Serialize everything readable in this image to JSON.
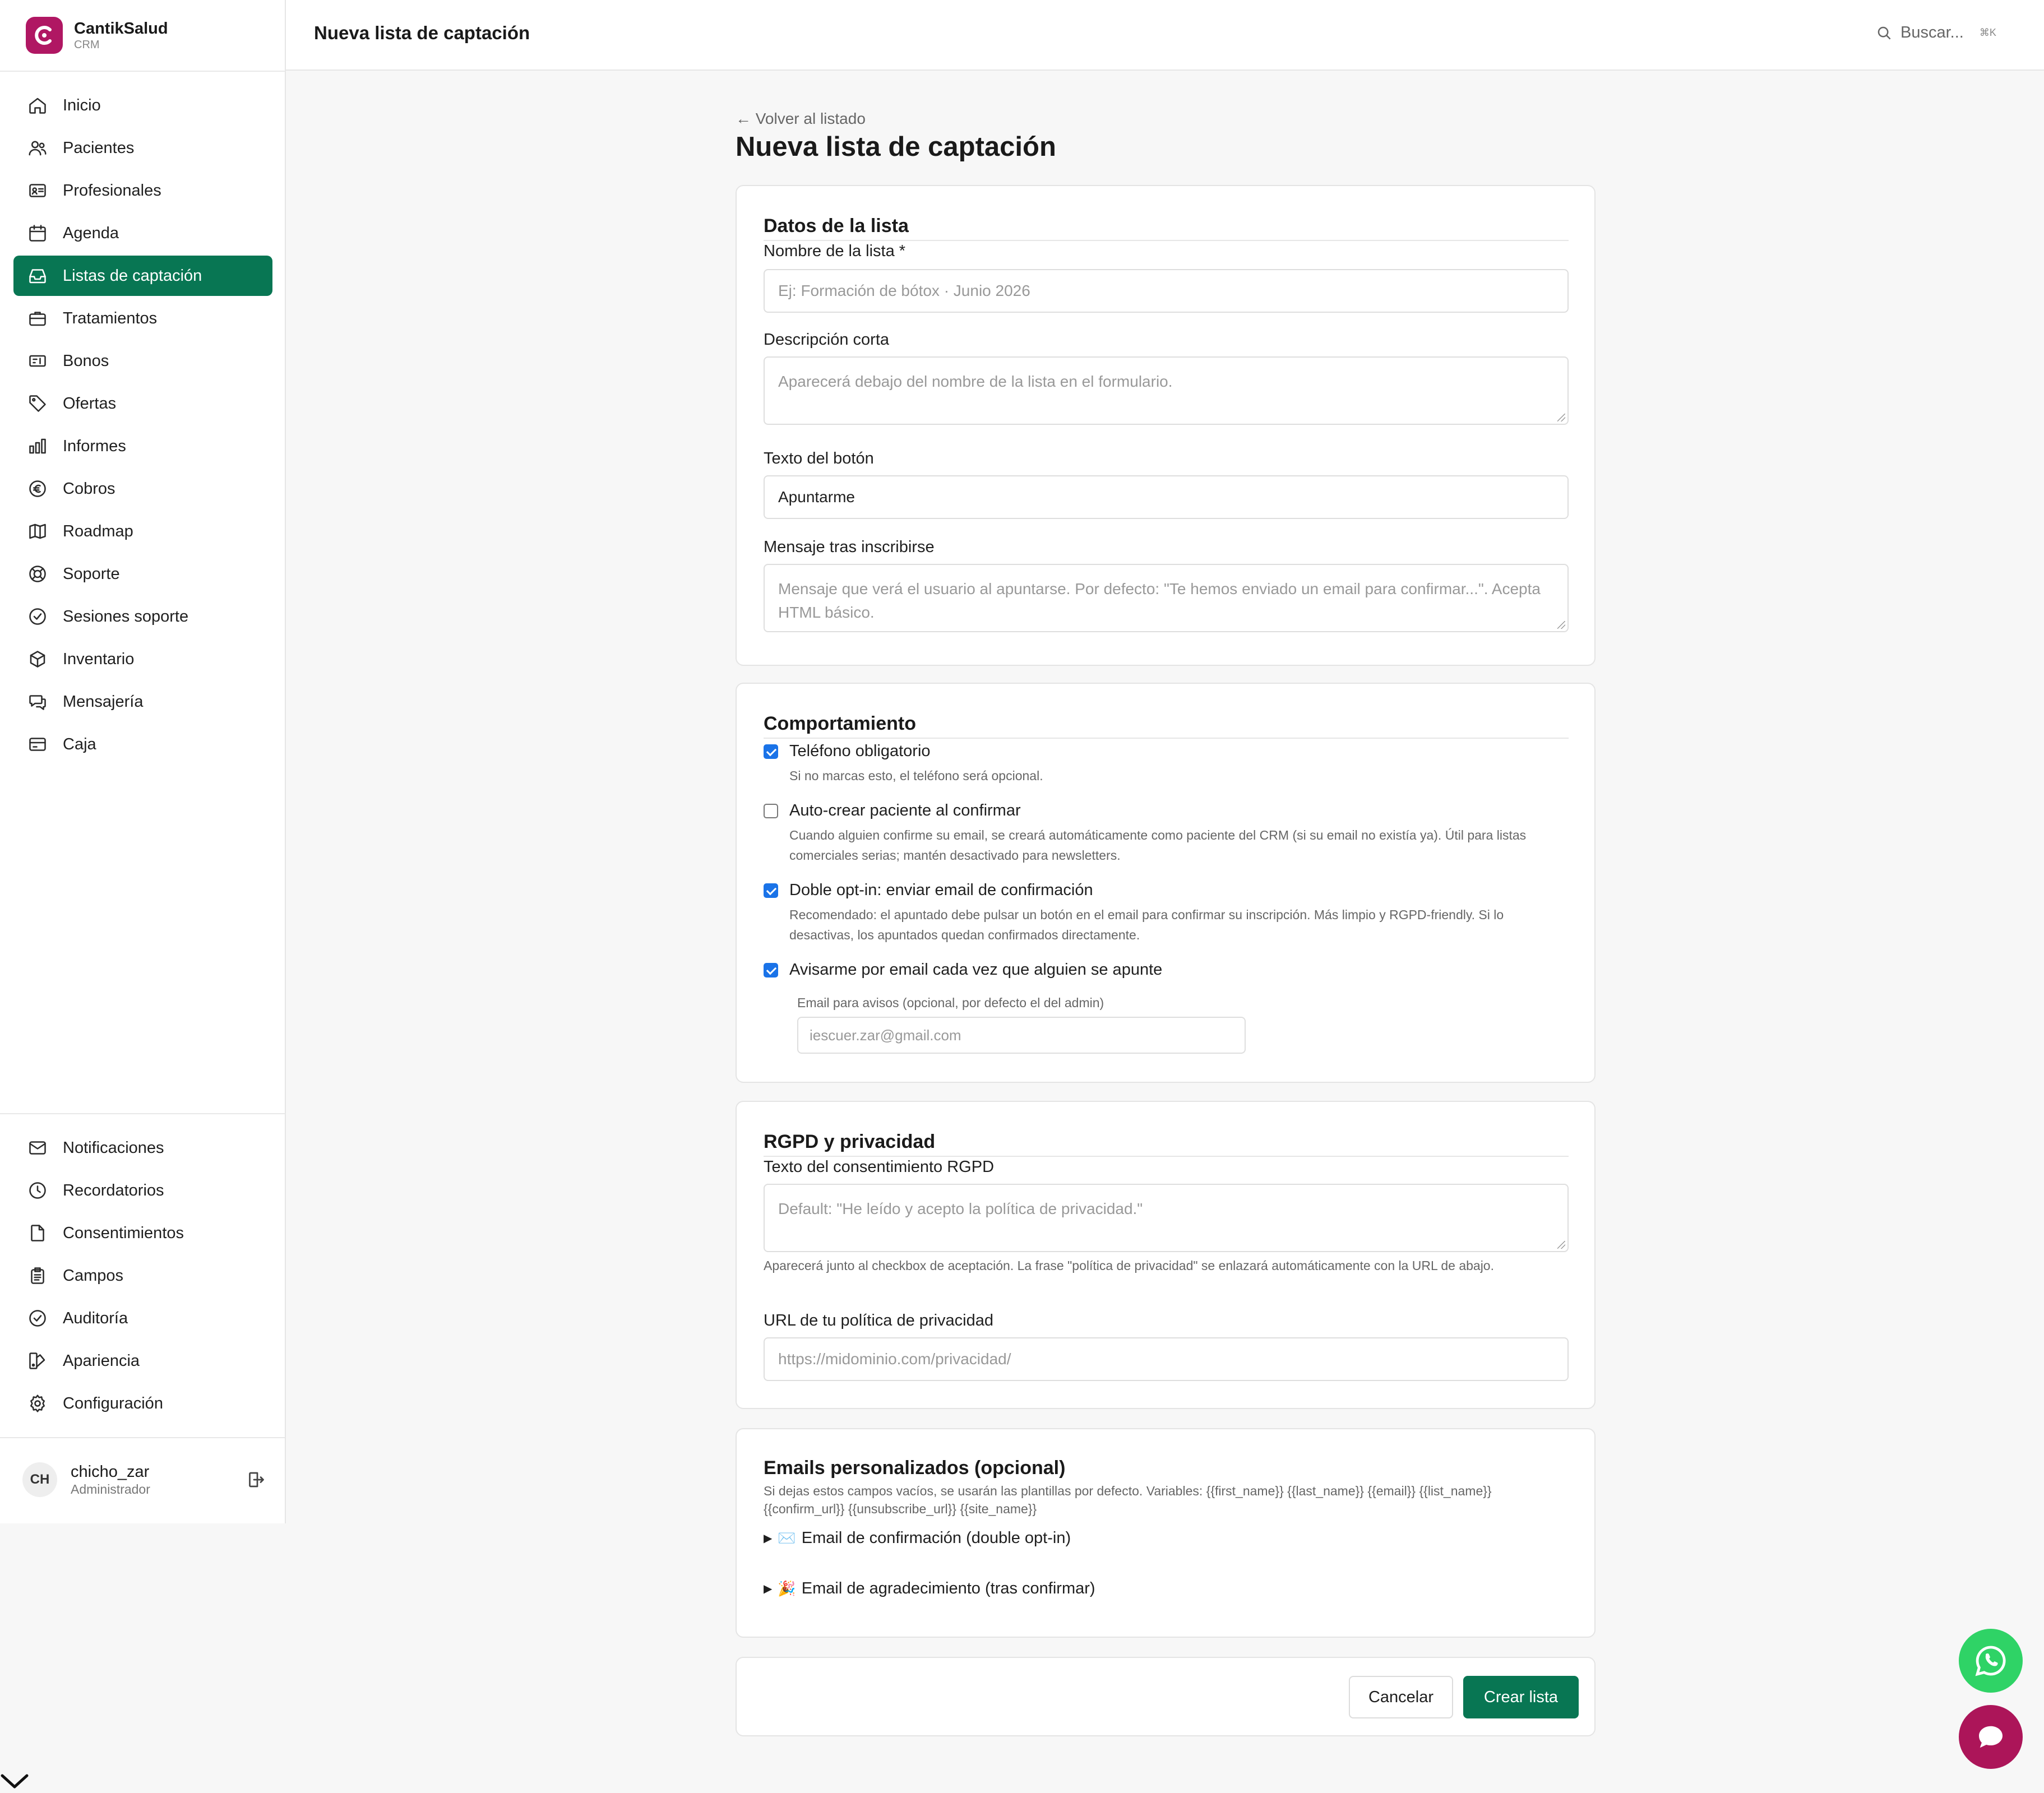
{
  "brand": {
    "name": "CantikSalud",
    "subtitle": "CRM",
    "color": "#b01763"
  },
  "sidebar": {
    "items": [
      {
        "label": "Inicio",
        "icon": "home-icon"
      },
      {
        "label": "Pacientes",
        "icon": "users-icon"
      },
      {
        "label": "Profesionales",
        "icon": "id-card-icon"
      },
      {
        "label": "Agenda",
        "icon": "calendar-icon"
      },
      {
        "label": "Listas de captación",
        "icon": "inbox-icon",
        "active": true
      },
      {
        "label": "Tratamientos",
        "icon": "briefcase-icon"
      },
      {
        "label": "Bonos",
        "icon": "ticket-icon"
      },
      {
        "label": "Ofertas",
        "icon": "tag-icon"
      },
      {
        "label": "Informes",
        "icon": "bar-chart-icon"
      },
      {
        "label": "Cobros",
        "icon": "euro-icon"
      },
      {
        "label": "Roadmap",
        "icon": "map-icon"
      },
      {
        "label": "Soporte",
        "icon": "lifebuoy-icon"
      },
      {
        "label": "Sesiones soporte",
        "icon": "check-badge-icon"
      },
      {
        "label": "Inventario",
        "icon": "box-icon"
      },
      {
        "label": "Mensajería",
        "icon": "messages-icon"
      },
      {
        "label": "Caja",
        "icon": "credit-card-icon"
      }
    ],
    "bottom_items": [
      {
        "label": "Notificaciones",
        "icon": "mail-icon"
      },
      {
        "label": "Recordatorios",
        "icon": "clock-icon"
      },
      {
        "label": "Consentimientos",
        "icon": "file-icon"
      },
      {
        "label": "Campos",
        "icon": "clipboard-icon"
      },
      {
        "label": "Auditoría",
        "icon": "shield-check-icon"
      },
      {
        "label": "Apariencia",
        "icon": "palette-icon"
      },
      {
        "label": "Configuración",
        "icon": "gear-icon"
      }
    ],
    "active_color": "#087653"
  },
  "user": {
    "initials": "CH",
    "name": "chicho_zar",
    "role": "Administrador"
  },
  "header": {
    "title": "Nueva lista de captación",
    "search_placeholder": "Buscar...",
    "shortcut": "⌘K"
  },
  "main": {
    "back_label": "← Volver al listado",
    "title": "Nueva lista de captación",
    "datos": {
      "title": "Datos de la lista",
      "nombre_label": "Nombre de la lista *",
      "nombre_placeholder": "Ej: Formación de bótox · Junio 2026",
      "descripcion_label": "Descripción corta",
      "descripcion_placeholder": "Aparecerá debajo del nombre de la lista en el formulario.",
      "boton_label": "Texto del botón",
      "boton_value": "Apuntarme",
      "mensaje_label": "Mensaje tras inscribirse",
      "mensaje_placeholder": "Mensaje que verá el usuario al apuntarse. Por defecto: \"Te hemos enviado un email para confirmar...\". Acepta HTML básico."
    },
    "comportamiento": {
      "title": "Comportamiento",
      "options": [
        {
          "label": "Teléfono obligatorio",
          "help": "Si no marcas esto, el teléfono será opcional.",
          "checked": true
        },
        {
          "label": "Auto-crear paciente al confirmar",
          "help": "Cuando alguien confirme su email, se creará automáticamente como paciente del CRM (si su email no existía ya). Útil para listas comerciales serias; mantén desactivado para newsletters.",
          "checked": false
        },
        {
          "label": "Doble opt-in: enviar email de confirmación",
          "help": "Recomendado: el apuntado debe pulsar un botón en el email para confirmar su inscripción. Más limpio y RGPD-friendly. Si lo desactivas, los apuntados quedan confirmados directamente.",
          "checked": true
        },
        {
          "label": "Avisarme por email cada vez que alguien se apunte",
          "help": "",
          "checked": true
        }
      ],
      "aviso_label": "Email para avisos (opcional, por defecto el del admin)",
      "aviso_placeholder": "iescuer.zar@gmail.com"
    },
    "rgpd": {
      "title": "RGPD y privacidad",
      "consent_label": "Texto del consentimiento RGPD",
      "consent_placeholder": "Default: \"He leído y acepto la política de privacidad.\"",
      "consent_help": "Aparecerá junto al checkbox de aceptación. La frase \"política de privacidad\" se enlazará automáticamente con la URL de abajo.",
      "url_label": "URL de tu política de privacidad",
      "url_placeholder": "https://midominio.com/privacidad/"
    },
    "emails": {
      "title": "Emails personalizados (opcional)",
      "help": "Si dejas estos campos vacíos, se usarán las plantillas por defecto. Variables: {{first_name}} {{last_name}} {{email}} {{list_name}} {{confirm_url}} {{unsubscribe_url}} {{site_name}}",
      "confirm_emoji": "✉️",
      "confirm_label": "Email de confirmación (double opt-in)",
      "thanks_emoji": "🎉",
      "thanks_label": "Email de agradecimiento (tras confirmar)"
    },
    "actions": {
      "cancel_label": "Cancelar",
      "submit_label": "Crear lista"
    }
  },
  "colors": {
    "whatsapp": "#2fd366",
    "chat": "#ac1559",
    "checkbox": "#1a73e8"
  }
}
